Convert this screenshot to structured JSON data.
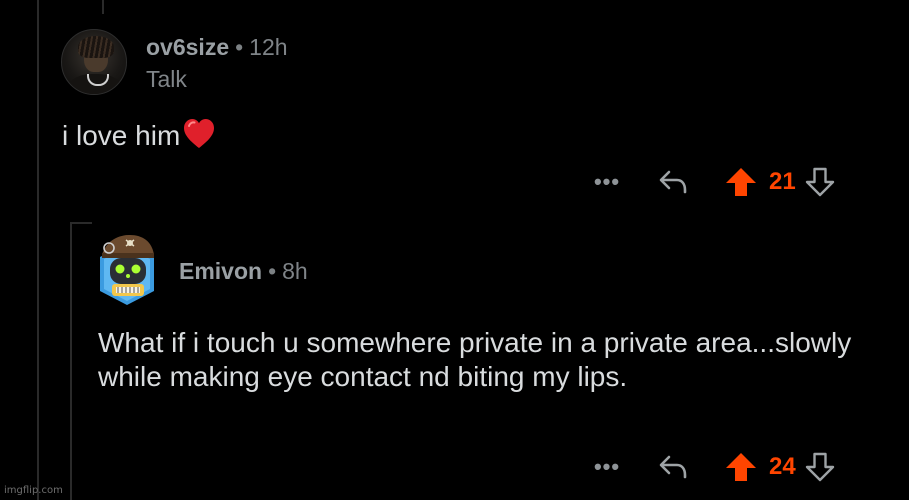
{
  "comments": [
    {
      "username": "ov6size",
      "separator": "•",
      "age": "12h",
      "flair": "Talk",
      "body": "i love him",
      "emoji": "heart-emoji",
      "more_label": "•••",
      "score": "21",
      "avatar": "user-photo-avatar"
    },
    {
      "username": "Emivon",
      "separator": "•",
      "age": "8h",
      "body": "What if i touch u somewhere private in a private area...slowly while making eye contact nd biting my lips.",
      "more_label": "•••",
      "score": "24",
      "avatar": "robot-pirate-avatar"
    }
  ],
  "colors": {
    "background": "#000000",
    "upvote_active": "#ff4500",
    "text_primary": "#d9dcde",
    "text_secondary": "#9aa0a4"
  },
  "watermark": "imgflip.com"
}
